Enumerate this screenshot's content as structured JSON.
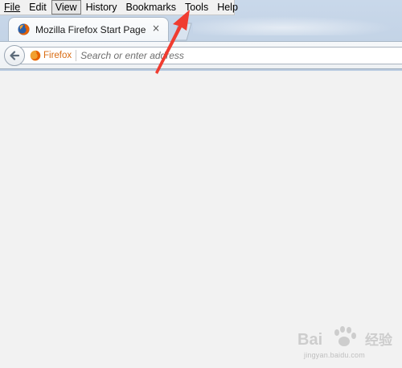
{
  "menubar": {
    "items": [
      {
        "label": "File"
      },
      {
        "label": "Edit"
      },
      {
        "label": "View"
      },
      {
        "label": "History"
      },
      {
        "label": "Bookmarks"
      },
      {
        "label": "Tools"
      },
      {
        "label": "Help"
      }
    ],
    "active": "View"
  },
  "tab": {
    "title": "Mozilla Firefox Start Page",
    "close_glyph": "×"
  },
  "navbar": {
    "identity_label": "Firefox",
    "url_placeholder": "Search or enter address"
  },
  "colors": {
    "accent_orange": "#e66000",
    "annotation_arrow": "#f03c30",
    "content_bg": "#f2f2f2"
  },
  "watermark": {
    "text": "jingyan.baidu.com"
  }
}
